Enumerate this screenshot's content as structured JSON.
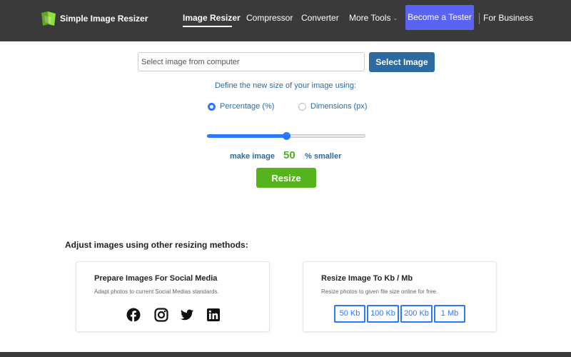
{
  "header": {
    "brand": "Simple Image Resizer",
    "nav": {
      "image_resizer": "Image Resizer",
      "compressor": "Compressor",
      "converter": "Converter",
      "more_tools": "More Tools",
      "become_tester": "Become a Tester",
      "for_business": "For Business"
    },
    "colors": {
      "header_bg": "#3a3a3a",
      "tester_bg": "#5b63f2",
      "logo_green": "#7ed321"
    }
  },
  "upload": {
    "placeholder": "Select image from computer",
    "select_button": "Select Image"
  },
  "resize_options": {
    "define_text": "Define the new size of your image using:",
    "option_percentage": "Percentage (%)",
    "option_dimensions": "Dimensions (px)",
    "selected": "percentage"
  },
  "slider": {
    "value_fraction": 0.5
  },
  "make_image": {
    "prefix": "make image",
    "value": "50",
    "suffix": "% smaller"
  },
  "resize_button": "Resize",
  "other_methods": {
    "heading": "Adjust images using other resizing methods:",
    "social_card": {
      "title": "Prepare Images For Social Media",
      "description": "Adapt photos to current Social Medias standards.",
      "icons": [
        "facebook-icon",
        "instagram-icon",
        "twitter-icon",
        "linkedin-icon"
      ]
    },
    "kb_card": {
      "title": "Resize Image To Kb / Mb",
      "description": "Resize photos to given file size online for free.",
      "buttons": [
        "50 Kb",
        "100 Kb",
        "200 Kb",
        "1 Mb"
      ]
    }
  },
  "colors": {
    "accent_blue": "#2979ff",
    "text_blue": "#2d6a9f",
    "green": "#55b31c"
  }
}
